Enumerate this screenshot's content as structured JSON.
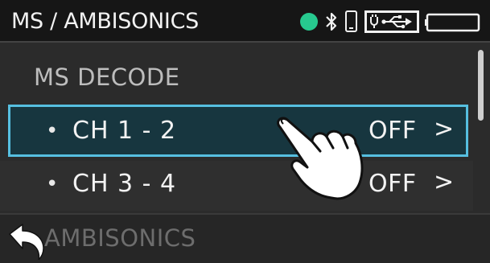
{
  "status_bar": {
    "title": "MS / AMBISONICS",
    "indicator_color": "#27c98f",
    "icons": [
      "status-dot",
      "bluetooth-icon",
      "phone-icon",
      "usb-icon",
      "battery-icon"
    ]
  },
  "list": {
    "section_header": "MS DECODE",
    "items": [
      {
        "bullet": "•",
        "label": "CH 1 - 2",
        "value": "OFF",
        "chevron": ">",
        "selected": true
      },
      {
        "bullet": "•",
        "label": "CH 3 - 4",
        "value": "OFF",
        "chevron": ">",
        "selected": false
      }
    ],
    "next_section": "AMBISONICS"
  },
  "colors": {
    "selection_border": "#56bfe0",
    "selection_fill": "#17363f",
    "background": "#2b2b2b",
    "status_bar": "#161616"
  }
}
